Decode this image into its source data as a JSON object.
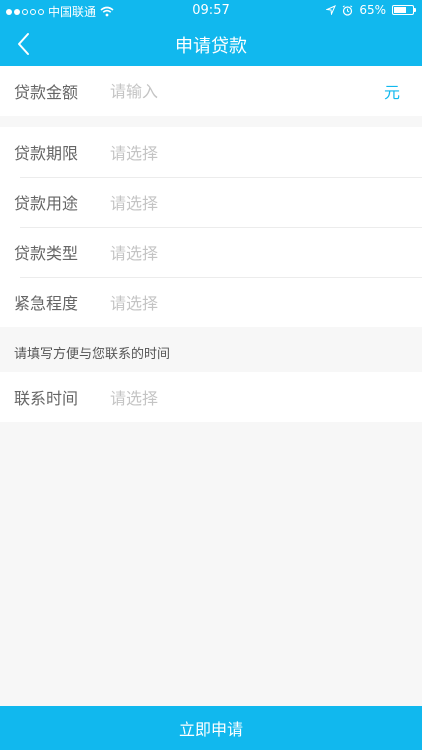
{
  "status_bar": {
    "carrier": "中国联通",
    "time": "09:57",
    "battery": "65%",
    "battery_level": 0.65
  },
  "nav": {
    "title": "申请贷款"
  },
  "amount": {
    "label": "贷款金额",
    "placeholder": "请输入",
    "value": "",
    "unit": "元"
  },
  "fields": [
    {
      "label": "贷款期限",
      "value": "请选择"
    },
    {
      "label": "贷款用途",
      "value": "请选择"
    },
    {
      "label": "贷款类型",
      "value": "请选择"
    },
    {
      "label": "紧急程度",
      "value": "请选择"
    }
  ],
  "contact_hint": "请填写方便与您联系的时间",
  "contact": {
    "label": "联系时间",
    "value": "请选择"
  },
  "submit_label": "立即申请",
  "colors": {
    "accent": "#11b8ee",
    "background": "#f7f7f7"
  }
}
